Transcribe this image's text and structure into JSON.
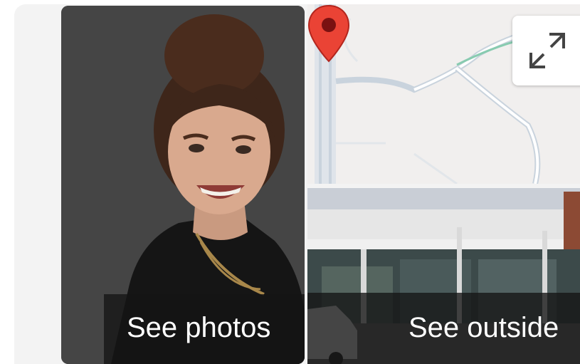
{
  "photos_tile": {
    "label": "See photos",
    "image": "person-portrait"
  },
  "map_tile": {
    "expand_button": {
      "icon": "expand-icon"
    },
    "marker": {
      "icon": "location-pin-icon",
      "color": "#ea4335"
    }
  },
  "street_tile": {
    "label": "See outside",
    "image": "storefront-street-view"
  },
  "colors": {
    "scrim": "#1f1f1f",
    "pin": "#ea4335",
    "map_background": "#f1efee",
    "map_road": "#c9d3dd",
    "map_route": "#88cbb0"
  }
}
